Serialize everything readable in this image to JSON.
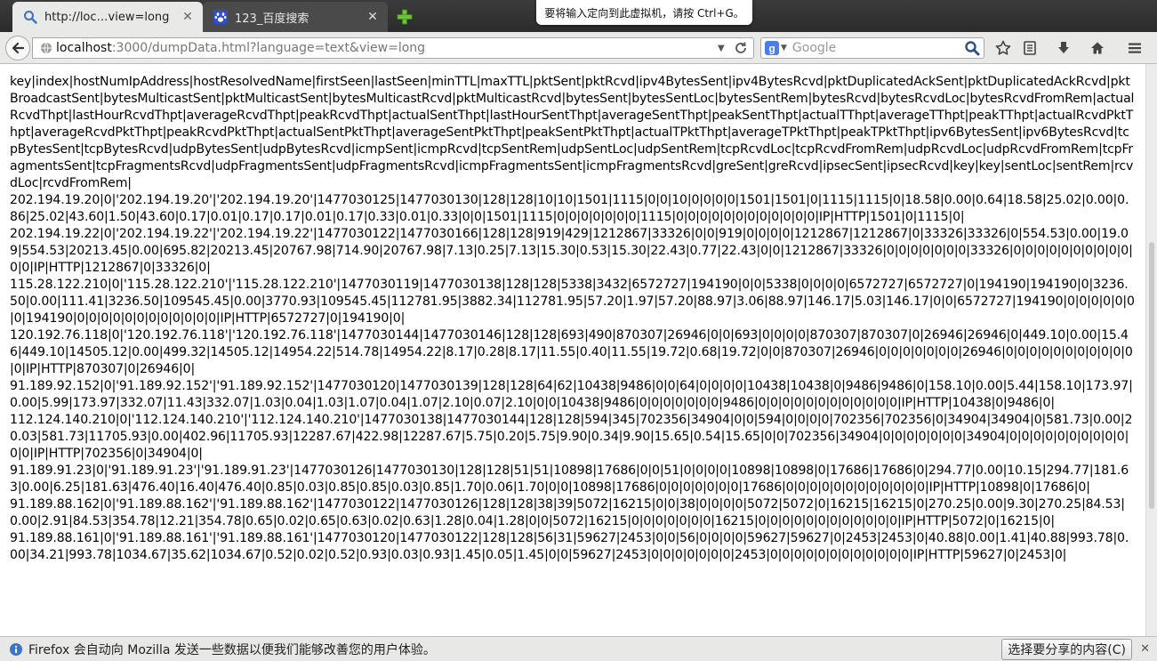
{
  "tabs": [
    {
      "title": "http://loc…view=long",
      "icon": "search-icon"
    },
    {
      "title": "123_百度搜索",
      "icon": "baidu-paw-icon"
    }
  ],
  "notification_popup": "要将输入定向到此虚拟机，请按 Ctrl+G。",
  "urlbar": {
    "host": "localhost",
    "rest": ":3000/dumpData.html?language=text&view=long"
  },
  "searchbar": {
    "placeholder": "Google"
  },
  "content": {
    "text": "key|index|hostNumIpAddress|hostResolvedName|firstSeen|lastSeen|minTTL|maxTTL|pktSent|pktRcvd|ipv4BytesSent|ipv4BytesRcvd|pktDuplicatedAckSent|pktDuplicatedAckRcvd|pktBroadcastSent|bytesMulticastSent|pktMulticastSent|bytesMulticastRcvd|pktMulticastRcvd|bytesSent|bytesSentLoc|bytesSentRem|bytesRcvd|bytesRcvdLoc|bytesRcvdFromRem|actualRcvdThpt|lastHourRcvdThpt|averageRcvdThpt|peakRcvdThpt|actualSentThpt|lastHourSentThpt|averageSentThpt|peakSentThpt|actualTThpt|averageTThpt|peakTThpt|actualRcvdPktThpt|averageRcvdPktThpt|peakRcvdPktThpt|actualSentPktThpt|averageSentPktThpt|peakSentPktThpt|actualTPktThpt|averageTPktThpt|peakTPktThpt|ipv6BytesSent|ipv6BytesRcvd|tcpBytesSent|tcpBytesRcvd|udpBytesSent|udpBytesRcvd|icmpSent|icmpRcvd|tcpSentRem|udpSentLoc|udpSentRem|tcpRcvdLoc|tcpRcvdFromRem|udpRcvdLoc|udpRcvdFromRem|tcpFragmentsSent|tcpFragmentsRcvd|udpFragmentsSent|udpFragmentsRcvd|icmpFragmentsSent|icmpFragmentsRcvd|greSent|greRcvd|ipsecSent|ipsecRcvd|key|key|sentLoc|sentRem|rcvdLoc|rcvdFromRem|\n202.194.19.20|0|'202.194.19.20'|'202.194.19.20'|1477030125|1477030130|128|128|10|10|1501|1115|0|0|10|0|0|0|0|1501|1501|0|1115|1115|0|18.58|0.00|0.64|18.58|25.02|0.00|0.86|25.02|43.60|1.50|43.60|0.17|0.01|0.17|0.17|0.01|0.17|0.33|0.01|0.33|0|0|1501|1115|0|0|0|0|0|0|0|1115|0|0|0|0|0|0|0|0|0|0|0|0|IP|HTTP|1501|0|1115|0|\n202.194.19.22|0|'202.194.19.22'|'202.194.19.22'|1477030122|1477030166|128|128|919|429|1212867|33326|0|0|919|0|0|0|0|1212867|1212867|0|33326|33326|0|554.53|0.00|19.09|554.53|20213.45|0.00|695.82|20213.45|20767.98|714.90|20767.98|7.13|0.25|7.13|15.30|0.53|15.30|22.43|0.77|22.43|0|0|1212867|33326|0|0|0|0|0|0|0|33326|0|0|0|0|0|0|0|0|0|0|0|0|IP|HTTP|1212867|0|33326|0|\n115.28.122.210|0|'115.28.122.210'|'115.28.122.210'|1477030119|1477030138|128|128|5338|3432|6572727|194190|0|0|5338|0|0|0|0|6572727|6572727|0|194190|194190|0|3236.50|0.00|111.41|3236.50|109545.45|0.00|3770.93|109545.45|112781.95|3882.34|112781.95|57.20|1.97|57.20|88.97|3.06|88.97|146.17|5.03|146.17|0|0|6572727|194190|0|0|0|0|0|0|0|194190|0|0|0|0|0|0|0|0|0|0|0|0|IP|HTTP|6572727|0|194190|0|\n120.192.76.118|0|'120.192.76.118'|'120.192.76.118'|1477030144|1477030146|128|128|693|490|870307|26946|0|0|693|0|0|0|0|870307|870307|0|26946|26946|0|449.10|0.00|15.46|449.10|14505.12|0.00|499.32|14505.12|14954.22|514.78|14954.22|8.17|0.28|8.17|11.55|0.40|11.55|19.72|0.68|19.72|0|0|870307|26946|0|0|0|0|0|0|0|26946|0|0|0|0|0|0|0|0|0|0|0|0|IP|HTTP|870307|0|26946|0|\n91.189.92.152|0|'91.189.92.152'|'91.189.92.152'|1477030120|1477030139|128|128|64|62|10438|9486|0|0|64|0|0|0|0|10438|10438|0|9486|9486|0|158.10|0.00|5.44|158.10|173.97|0.00|5.99|173.97|332.07|11.43|332.07|1.03|0.04|1.03|1.07|0.04|1.07|2.10|0.07|2.10|0|0|10438|9486|0|0|0|0|0|0|0|9486|0|0|0|0|0|0|0|0|0|0|0|0|IP|HTTP|10438|0|9486|0|\n112.124.140.210|0|'112.124.140.210'|'112.124.140.210'|1477030138|1477030144|128|128|594|345|702356|34904|0|0|594|0|0|0|0|702356|702356|0|34904|34904|0|581.73|0.00|20.03|581.73|11705.93|0.00|402.96|11705.93|12287.67|422.98|12287.67|5.75|0.20|5.75|9.90|0.34|9.90|15.65|0.54|15.65|0|0|702356|34904|0|0|0|0|0|0|0|34904|0|0|0|0|0|0|0|0|0|0|0|0|IP|HTTP|702356|0|34904|0|\n91.189.91.23|0|'91.189.91.23'|'91.189.91.23'|1477030126|1477030130|128|128|51|51|10898|17686|0|0|51|0|0|0|0|10898|10898|0|17686|17686|0|294.77|0.00|10.15|294.77|181.63|0.00|6.25|181.63|476.40|16.40|476.40|0.85|0.03|0.85|0.85|0.03|0.85|1.70|0.06|1.70|0|0|10898|17686|0|0|0|0|0|0|0|17686|0|0|0|0|0|0|0|0|0|0|0|0|IP|HTTP|10898|0|17686|0|\n91.189.88.162|0|'91.189.88.162'|'91.189.88.162'|1477030122|1477030126|128|128|38|39|5072|16215|0|0|38|0|0|0|0|5072|5072|0|16215|16215|0|270.25|0.00|9.30|270.25|84.53|0.00|2.91|84.53|354.78|12.21|354.78|0.65|0.02|0.65|0.63|0.02|0.63|1.28|0.04|1.28|0|0|5072|16215|0|0|0|0|0|0|0|16215|0|0|0|0|0|0|0|0|0|0|0|0|IP|HTTP|5072|0|16215|0|\n91.189.88.161|0|'91.189.88.161'|'91.189.88.161'|1477030120|1477030122|128|128|56|31|59627|2453|0|0|56|0|0|0|0|59627|59627|0|2453|2453|0|40.88|0.00|1.41|40.88|993.78|0.00|34.21|993.78|1034.67|35.62|1034.67|0.52|0.02|0.52|0.93|0.03|0.93|1.45|0.05|1.45|0|0|59627|2453|0|0|0|0|0|0|0|2453|0|0|0|0|0|0|0|0|0|0|0|0|IP|HTTP|59627|0|2453|0|"
  },
  "infobar": {
    "message": "Firefox 会自动向 Mozilla 发送一些数据以便我们能够改善您的用户体验。",
    "button_label": "选择要分享的内容(C)"
  }
}
